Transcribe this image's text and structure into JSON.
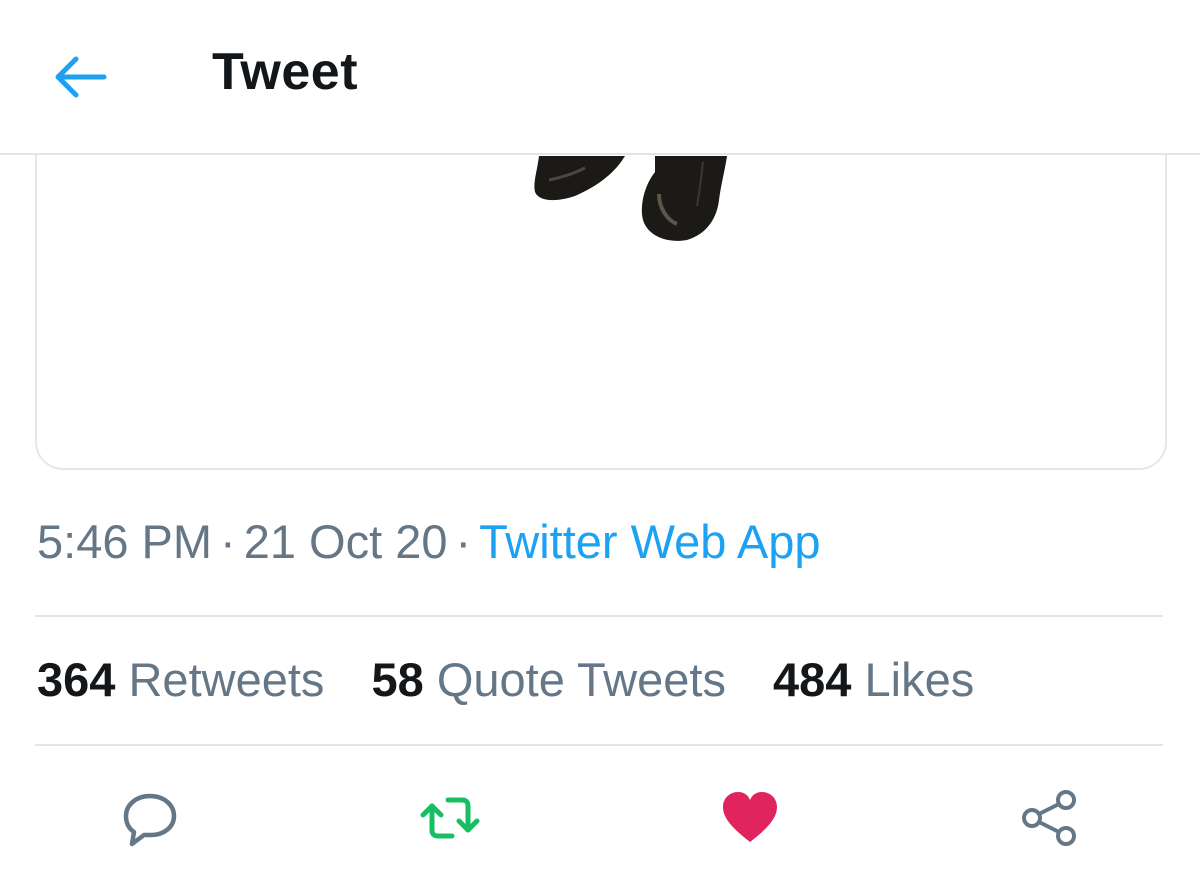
{
  "header": {
    "title": "Tweet",
    "back_icon": "arrow-left-icon",
    "accent_color": "#1da1f2"
  },
  "tweet": {
    "time": "5:46 PM",
    "date": "21 Oct 20",
    "separator": "·",
    "source": "Twitter Web App",
    "stats": {
      "retweets_count": "364",
      "retweets_label": "Retweets",
      "quote_tweets_count": "58",
      "quote_tweets_label": "Quote Tweets",
      "likes_count": "484",
      "likes_label": "Likes"
    }
  },
  "actions": [
    {
      "name": "reply",
      "icon": "reply-icon",
      "color": "#657786"
    },
    {
      "name": "retweet",
      "icon": "retweet-icon",
      "color": "#17bf63",
      "active": true
    },
    {
      "name": "like",
      "icon": "heart-icon",
      "color": "#e0245e",
      "active": true
    },
    {
      "name": "share",
      "icon": "share-icon",
      "color": "#657786"
    }
  ]
}
